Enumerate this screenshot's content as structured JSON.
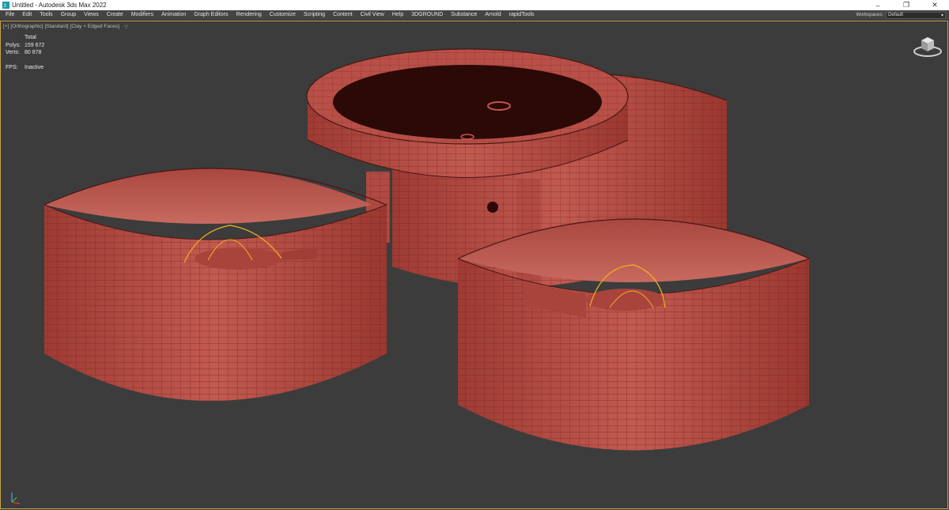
{
  "window": {
    "title": "Untitled - Autodesk 3ds Max 2022",
    "app_icon": "3dsmax-logo-icon",
    "controls": [
      "minimize-icon",
      "restore-icon",
      "close-icon"
    ]
  },
  "menubar": {
    "items": [
      "File",
      "Edit",
      "Tools",
      "Group",
      "Views",
      "Create",
      "Modifiers",
      "Animation",
      "Graph Editors",
      "Rendering",
      "Customize",
      "Scripting",
      "Content",
      "Civil View",
      "Help",
      "3DGROUND",
      "Substance",
      "Arnold",
      "rapidTools"
    ],
    "workspaces_label": "Workspaces:",
    "workspaces_value": "Default"
  },
  "viewport": {
    "label_plus": "[+]",
    "label_view": "[Orthographic]",
    "label_shading_std": "[Standard]",
    "label_shading": "[Clay + Edged Faces]",
    "filter_icon": "filter-icon",
    "stats": {
      "header": "Total",
      "polys_label": "Polys:",
      "polys_value": "159 672",
      "verts_label": "Verts:",
      "verts_value": "80 878",
      "fps_label": "FPS:",
      "fps_value": "Inactive"
    },
    "colors": {
      "clay": "#b54b43",
      "clay_dark": "#8e332c",
      "edge": "#5a1c17",
      "selection": "#f0b020",
      "background": "#3c3c3c"
    }
  }
}
